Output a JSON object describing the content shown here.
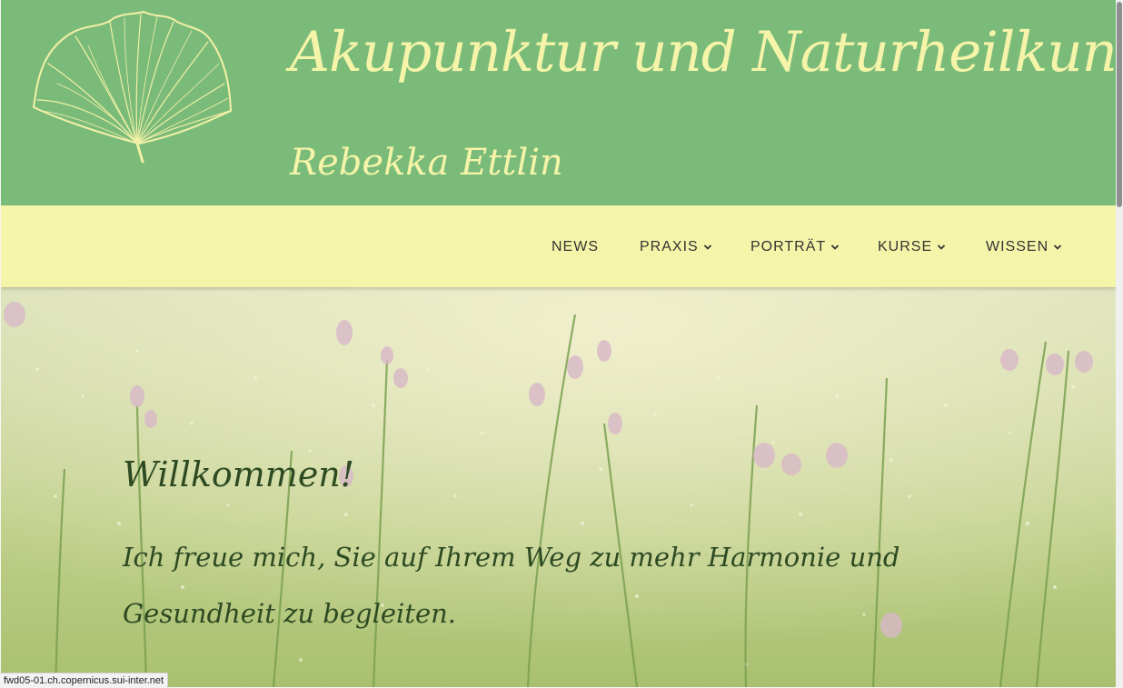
{
  "header": {
    "title": "Akupunktur und Naturheilkunde",
    "subtitle": "Rebekka Ettlin",
    "logo_icon": "ginkgo-leaf-icon"
  },
  "nav": {
    "items": [
      {
        "label": "NEWS",
        "has_dropdown": false
      },
      {
        "label": "PRAXIS",
        "has_dropdown": true
      },
      {
        "label": "PORTRÄT",
        "has_dropdown": true
      },
      {
        "label": "KURSE",
        "has_dropdown": true
      },
      {
        "label": "WISSEN",
        "has_dropdown": true
      }
    ]
  },
  "hero": {
    "heading": "Willkommen!",
    "text": "Ich freue mich, Sie auf Ihrem Weg zu mehr Harmonie und Gesundheit zu begleiten."
  },
  "status_bar": {
    "url": "fwd05-01.ch.copernicus.sui-inter.net"
  },
  "colors": {
    "header_bg": "#7bbb7a",
    "title_text": "#f5f4a8",
    "nav_bg": "#f5f5a9",
    "nav_text": "#333333",
    "hero_text": "#2d4a22"
  }
}
